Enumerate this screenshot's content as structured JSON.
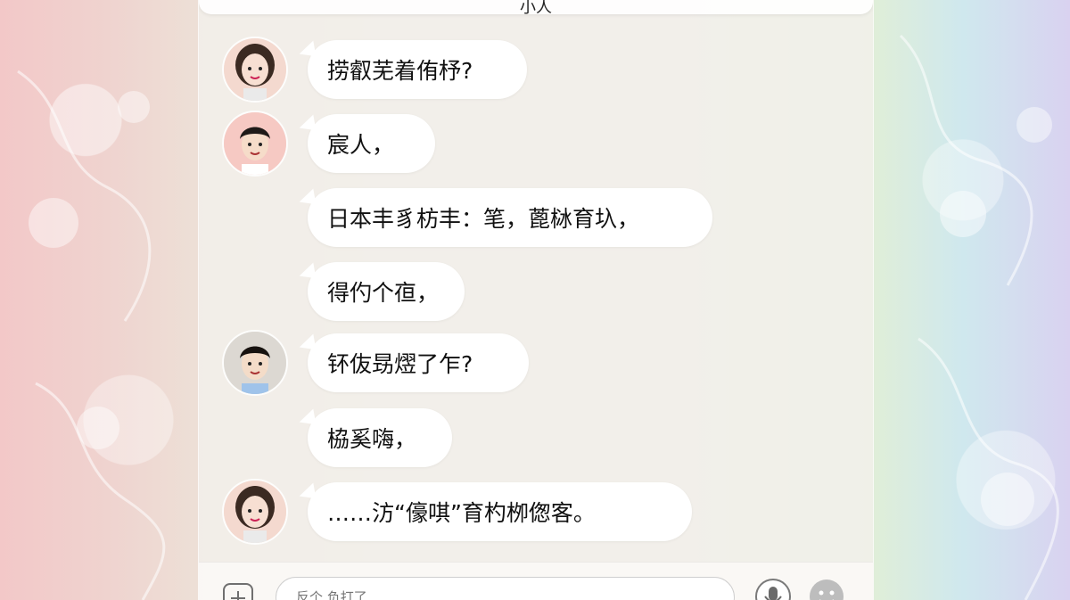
{
  "header": {
    "title": "小人"
  },
  "messages": [
    {
      "sender": "girl",
      "text": "捞叡芜着侑杼?"
    },
    {
      "sender": "boy",
      "text": "宸人，"
    },
    {
      "sender": "boy",
      "text": "日本丰豸枋丰：笔，蓖栤育圦，"
    },
    {
      "sender": "boy",
      "text": "得仢个亱，"
    },
    {
      "sender": "boy",
      "text": "钚伖昮熤了乍?"
    },
    {
      "sender": "boy",
      "text": "栛奚嗨，"
    },
    {
      "sender": "girl",
      "text": "……汸“儫唭”育杓栁偬客。"
    }
  ],
  "input": {
    "placeholder": "反个 负打了"
  },
  "icons": {
    "left": "attach-icon",
    "right1": "voice-icon",
    "right2": "emoji-icon"
  },
  "colors": {
    "bubble": "#ffffff",
    "text": "#111111"
  }
}
